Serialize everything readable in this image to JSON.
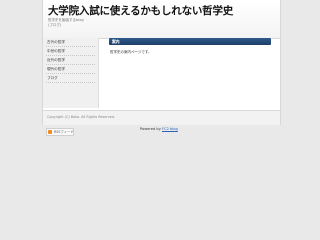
{
  "header": {
    "title": "大学院入試に使えるかもしれない哲学史",
    "subtitle_lines": [
      "哲学史を勉強するblog",
      "(ブログ)"
    ]
  },
  "sidebar": {
    "items": [
      {
        "label": "古代の哲学"
      },
      {
        "label": "中世の哲学"
      },
      {
        "label": "近代の哲学"
      },
      {
        "label": "現代の哲学"
      },
      {
        "label": "ブログ"
      }
    ],
    "rss_label": "RSSフィード"
  },
  "content": {
    "section_title": "案内",
    "text": "哲学史の案内ページです。"
  },
  "footer": {
    "copyright": "Copyright (C) Bako. All Rights Reserved.",
    "powered_prefix": "Powered by",
    "powered_link": "FC2 blog"
  },
  "colors": {
    "page_background": "#e9e9e9",
    "content_bar": "#1d3f68",
    "rss_icon": "#f08a24",
    "link": "#2a62b8"
  },
  "icons": [
    "rss-icon"
  ]
}
